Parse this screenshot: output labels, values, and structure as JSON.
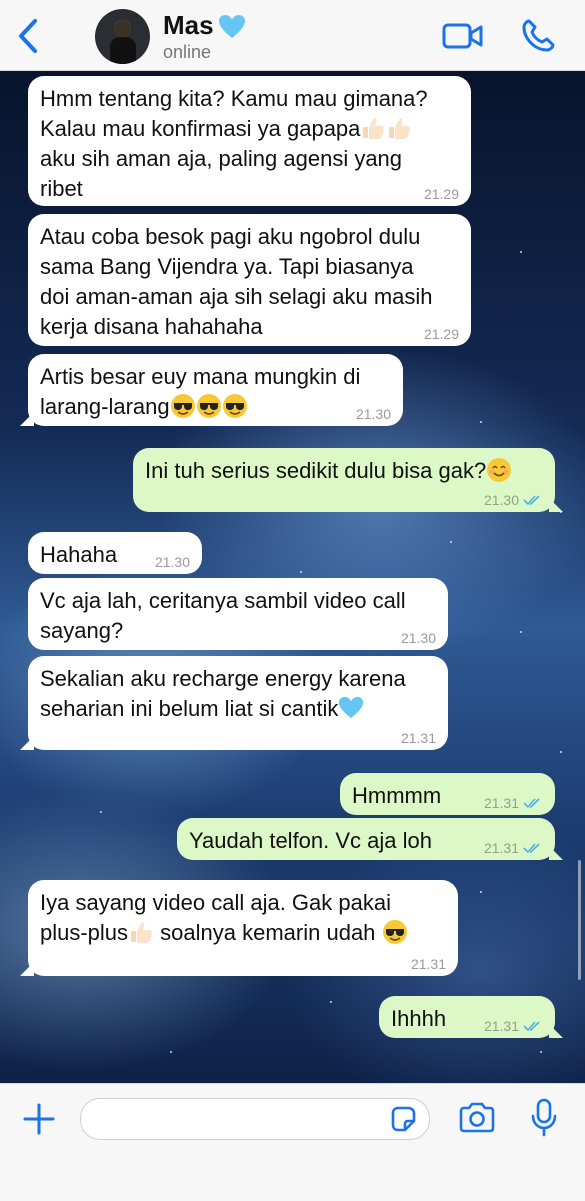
{
  "header": {
    "contact_name": "Mas",
    "status": "online",
    "accent_color": "#1a73e8"
  },
  "messages": [
    {
      "direction": "in",
      "line1": "Hmm tentang kita? Kamu mau gimana?",
      "line2": "Kalau mau konfirmasi ya gapapa",
      "line3": "aku sih aman aja, paling agensi yang",
      "line4": "ribet",
      "time": "21.29"
    },
    {
      "direction": "in",
      "line1": "Atau coba besok pagi aku ngobrol dulu",
      "line2": "sama Bang Vijendra ya. Tapi biasanya",
      "line3": "doi aman-aman aja sih selagi aku masih",
      "line4": "kerja disana hahahaha",
      "time": "21.29"
    },
    {
      "direction": "in",
      "line1": "Artis besar euy mana mungkin di",
      "line2": "larang-larang",
      "time": "21.30"
    },
    {
      "direction": "out",
      "line1": "Ini tuh serius sedikit dulu bisa gak?",
      "time": "21.30"
    },
    {
      "direction": "in",
      "line1": "Hahaha",
      "time": "21.30"
    },
    {
      "direction": "in",
      "line1": "Vc aja lah, ceritanya sambil video call",
      "line2": "sayang?",
      "time": "21.30"
    },
    {
      "direction": "in",
      "line1": "Sekalian aku recharge energy karena",
      "line2": "seharian ini belum liat si cantik",
      "time": "21.31"
    },
    {
      "direction": "out",
      "line1": "Hmmmm",
      "time": "21.31"
    },
    {
      "direction": "out",
      "line1": "Yaudah telfon. Vc aja loh",
      "time": "21.31"
    },
    {
      "direction": "in",
      "line1": "Iya sayang video call aja. Gak pakai",
      "line2a": "plus-plus",
      "line2b": "soalnya kemarin udah",
      "time": "21.31"
    },
    {
      "direction": "out",
      "line1": "Ihhhh",
      "time": "21.31"
    }
  ],
  "icons": {
    "back": "chevron-left-icon",
    "video": "video-camera-icon",
    "phone": "phone-icon",
    "plus": "plus-icon",
    "sticker": "sticker-icon",
    "camera": "camera-icon",
    "mic": "microphone-icon",
    "heart_emoji": "light-blue-heart",
    "thumbs_emoji": "thumbs-up-light-skin",
    "cool_emoji": "smiling-face-with-sunglasses",
    "smile_emoji": "smiling-face-with-smiling-eyes",
    "read_receipt": "double-check-icon"
  },
  "colors": {
    "incoming_bubble": "#ffffff",
    "outgoing_bubble": "#dcf8c6",
    "receipt_blue": "#4fb0e6"
  }
}
